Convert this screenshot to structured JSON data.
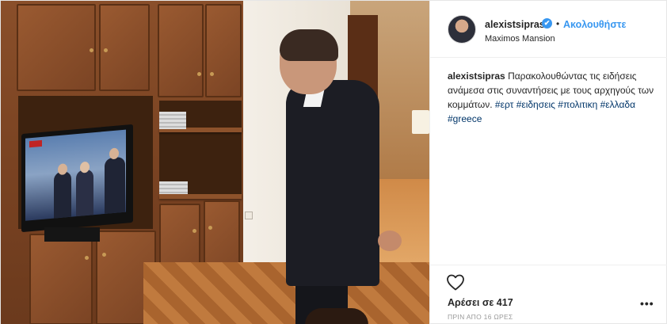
{
  "post": {
    "username": "alexistsipras",
    "verified_badge": "✔",
    "separator": "•",
    "follow_label": "Ακολουθήστε",
    "location": "Maximos Mansion",
    "caption": {
      "username": "alexistsipras",
      "text": "Παρακολουθώντας τις ειδήσεις ανάμεσα στις συναντήσεις με τους αρχηγούς των κομμάτων.",
      "hashtags": [
        "#ερτ",
        "#ειδησεις",
        "#πολιτικη",
        "#ελλαδα",
        "#greece"
      ]
    },
    "likes_label": "Αρέσει σε 417",
    "time_label": "ΠΡΙΝ ΑΠΟ 16 ΩΡΕΣ",
    "more_label": "•••",
    "tv_logo": "ΕΡΤ"
  },
  "icons": {
    "heart": "heart-icon",
    "verified": "verified-icon",
    "more": "more-options-icon"
  },
  "colors": {
    "accent": "#3897f0",
    "hashtag": "#003569",
    "text": "#262626",
    "muted": "#999999"
  }
}
